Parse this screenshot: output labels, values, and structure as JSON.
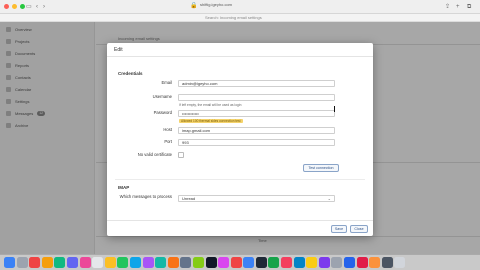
{
  "browser": {
    "url": "shiftig.igeyho.com",
    "subtitle": "Search: Incoming email settings"
  },
  "sidebar": {
    "items": [
      {
        "label": "Overview"
      },
      {
        "label": "Projects"
      },
      {
        "label": "Documents"
      },
      {
        "label": "Reports"
      },
      {
        "label": "Contacts"
      },
      {
        "label": "Calendar"
      },
      {
        "label": "Settings"
      },
      {
        "label": "Messages",
        "count": "12"
      },
      {
        "label": "Archive"
      }
    ]
  },
  "background": {
    "heading": "Incoming email settings",
    "column": "Time"
  },
  "modal": {
    "title": "Edit",
    "credentials_title": "Credentials",
    "email_label": "Email",
    "email_value": "admin@igeyho.com",
    "username_label": "Username",
    "username_value": "",
    "username_hint": "If left empty, the email will be used as login",
    "password_label": "Password",
    "password_value": "••••••••••••",
    "password_warning": "Allowed 100 thermal sides connection test",
    "host_label": "Host",
    "host_value": "imap.gmail.com",
    "port_label": "Port",
    "port_value": "993",
    "no_valid_cert_label": "No valid certificate",
    "test_connection_label": "Test connection",
    "imap_title": "IMAP",
    "which_messages_label": "Which messages to process",
    "which_messages_value": "Unread",
    "save_label": "Save",
    "close_label": "Close"
  },
  "colors": {
    "accent": "#2b4f85",
    "warning": "#f4d36b"
  }
}
